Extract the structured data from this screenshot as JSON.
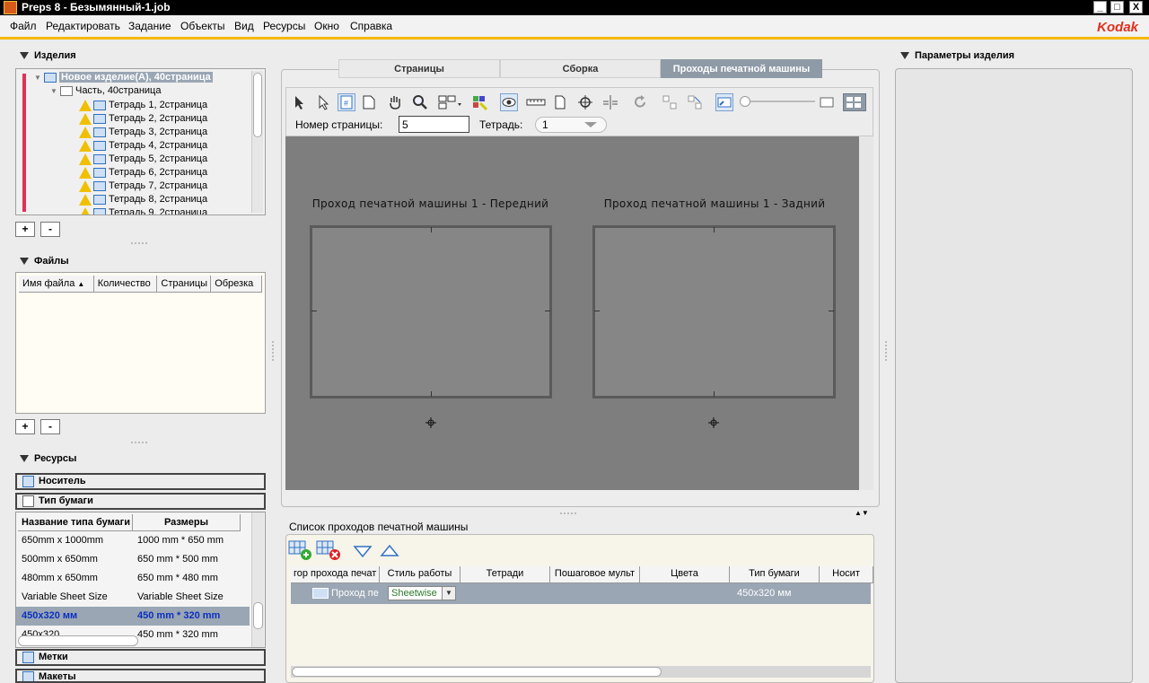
{
  "window": {
    "title": "Preps 8 - Безымянный-1.job",
    "min": "_",
    "max": "□",
    "close": "X"
  },
  "menu": [
    "Файл",
    "Редактировать",
    "Задание",
    "Объекты",
    "Вид",
    "Ресурсы",
    "Окно",
    "Справка"
  ],
  "brand": "Kodak",
  "products": {
    "header": "Изделия",
    "root": "Новое изделие(А), 40страница",
    "part": "Часть, 40страница",
    "signatures": [
      "Тетрадь 1, 2страница",
      "Тетрадь 2, 2страница",
      "Тетрадь 3, 2страница",
      "Тетрадь 4, 2страница",
      "Тетрадь 5, 2страница",
      "Тетрадь 6, 2страница",
      "Тетрадь 7, 2страница",
      "Тетрадь 8, 2страница",
      "Тетрадь 9, 2страница"
    ],
    "add": "+",
    "remove": "-"
  },
  "files": {
    "header": "Файлы",
    "columns": [
      "Имя файла",
      "Количество",
      "Страницы",
      "Обрезка"
    ],
    "add": "+",
    "remove": "-"
  },
  "resources": {
    "header": "Ресурсы",
    "groups": {
      "media": "Носитель",
      "paper": "Тип бумаги",
      "marks": "Метки",
      "templates": "Макеты"
    },
    "paper_columns": [
      "Название типа бумаги",
      "Размеры"
    ],
    "paper_rows": [
      {
        "name": "650mm x 1000mm",
        "size": "1000 mm * 650 mm"
      },
      {
        "name": "500mm x 650mm",
        "size": "650 mm * 500 mm"
      },
      {
        "name": "480mm x 650mm",
        "size": "650 mm * 480 mm"
      },
      {
        "name": "Variable Sheet Size",
        "size": "Variable Sheet Size"
      },
      {
        "name": "450x320 мм",
        "size": "450 mm * 320 mm"
      },
      {
        "name": "450x320",
        "size": "450 mm * 320 mm"
      }
    ],
    "selected_row": 4
  },
  "tabs": [
    "Страницы",
    "Сборка",
    "Проходы печатной машины"
  ],
  "active_tab": 2,
  "toolbar": {
    "page_label": "Номер страницы:",
    "page_value": "5",
    "sig_label": "Тетрадь:",
    "sig_value": "1"
  },
  "canvas": {
    "front": "Проход печатной машины 1 - Передний",
    "back": "Проход печатной машины 1 - Задний"
  },
  "runlist": {
    "header": "Список проходов печатной машины",
    "columns": [
      "гор прохода печат",
      "Стиль работы",
      "Тетради",
      "Пошаговое мульт",
      "Цвета",
      "Тип бумаги",
      "Носит"
    ],
    "row": {
      "name": "Проход пе",
      "style": "Sheetwise",
      "paper": "450x320 мм"
    }
  },
  "right": {
    "header": "Параметры изделия"
  },
  "colors": {
    "accent": "#f5b800",
    "brand": "#e0301e",
    "selected": "#9aa6b4",
    "canvas": "#7e7e7e"
  }
}
